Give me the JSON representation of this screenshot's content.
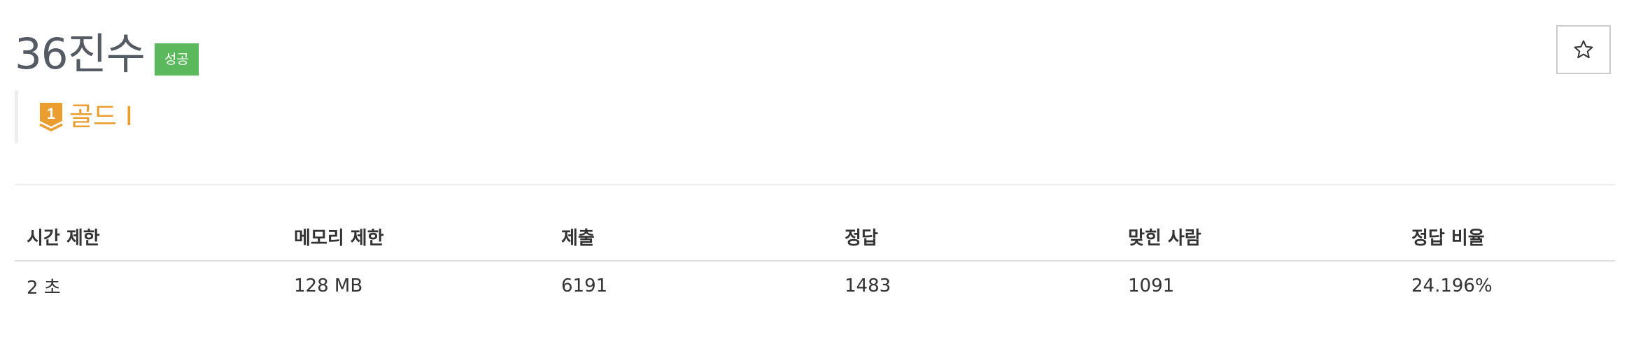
{
  "problem": {
    "title": "36진수",
    "result_badge": "성공",
    "tier": {
      "label": "골드 I",
      "level_number": "1",
      "color": "#eb9e2f"
    }
  },
  "actions": {
    "star_icon": "star-outline",
    "star_glyph": "☆"
  },
  "info_table": {
    "headers": [
      "시간 제한",
      "메모리 제한",
      "제출",
      "정답",
      "맞힌 사람",
      "정답 비율"
    ],
    "rows": [
      [
        "2 초",
        "128 MB",
        "6191",
        "1483",
        "1091",
        "24.196%"
      ]
    ]
  },
  "colors": {
    "badge_success": "#5cb85c",
    "title_text": "#555b63",
    "tier_gold": "#eb9e2f"
  }
}
